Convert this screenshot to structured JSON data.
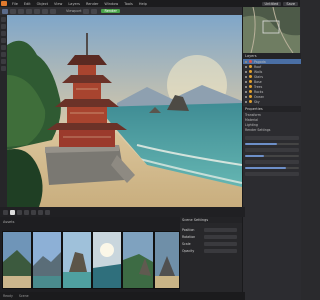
{
  "menubar": {
    "items": [
      "File",
      "Edit",
      "Object",
      "View",
      "Layers",
      "Render",
      "Window",
      "Tools",
      "Help"
    ],
    "right_buttons": [
      "Untitled",
      "Save"
    ]
  },
  "toolbar": {
    "mode_label": "Viewport",
    "render_button": "Render"
  },
  "layers_panel": {
    "title": "Layers",
    "items": [
      {
        "label": "Pagoda",
        "color": "#d9534f"
      },
      {
        "label": "Roof",
        "color": "#e0a030"
      },
      {
        "label": "Walls",
        "color": "#e0a030"
      },
      {
        "label": "Stairs",
        "color": "#e0a030"
      },
      {
        "label": "Base",
        "color": "#e0a030"
      },
      {
        "label": "Trees",
        "color": "#e0a030"
      },
      {
        "label": "Rocks",
        "color": "#e0a030"
      },
      {
        "label": "Ocean",
        "color": "#e0a030"
      },
      {
        "label": "Sky",
        "color": "#e0a030"
      }
    ]
  },
  "properties_panel": {
    "title": "Properties",
    "sections": [
      "Transform",
      "Material",
      "Lighting",
      "Render Settings"
    ]
  },
  "bottom_props": {
    "title": "Scene Settings",
    "fields": [
      "Position",
      "Rotation",
      "Scale",
      "Opacity"
    ]
  },
  "asset_panel": {
    "title": "Assets"
  },
  "statusbar": {
    "left": "Ready",
    "middle": "Scene"
  },
  "colors": {
    "accent": "#e07a2e",
    "selection": "#4a6fa5",
    "ok": "#4aa34a"
  }
}
